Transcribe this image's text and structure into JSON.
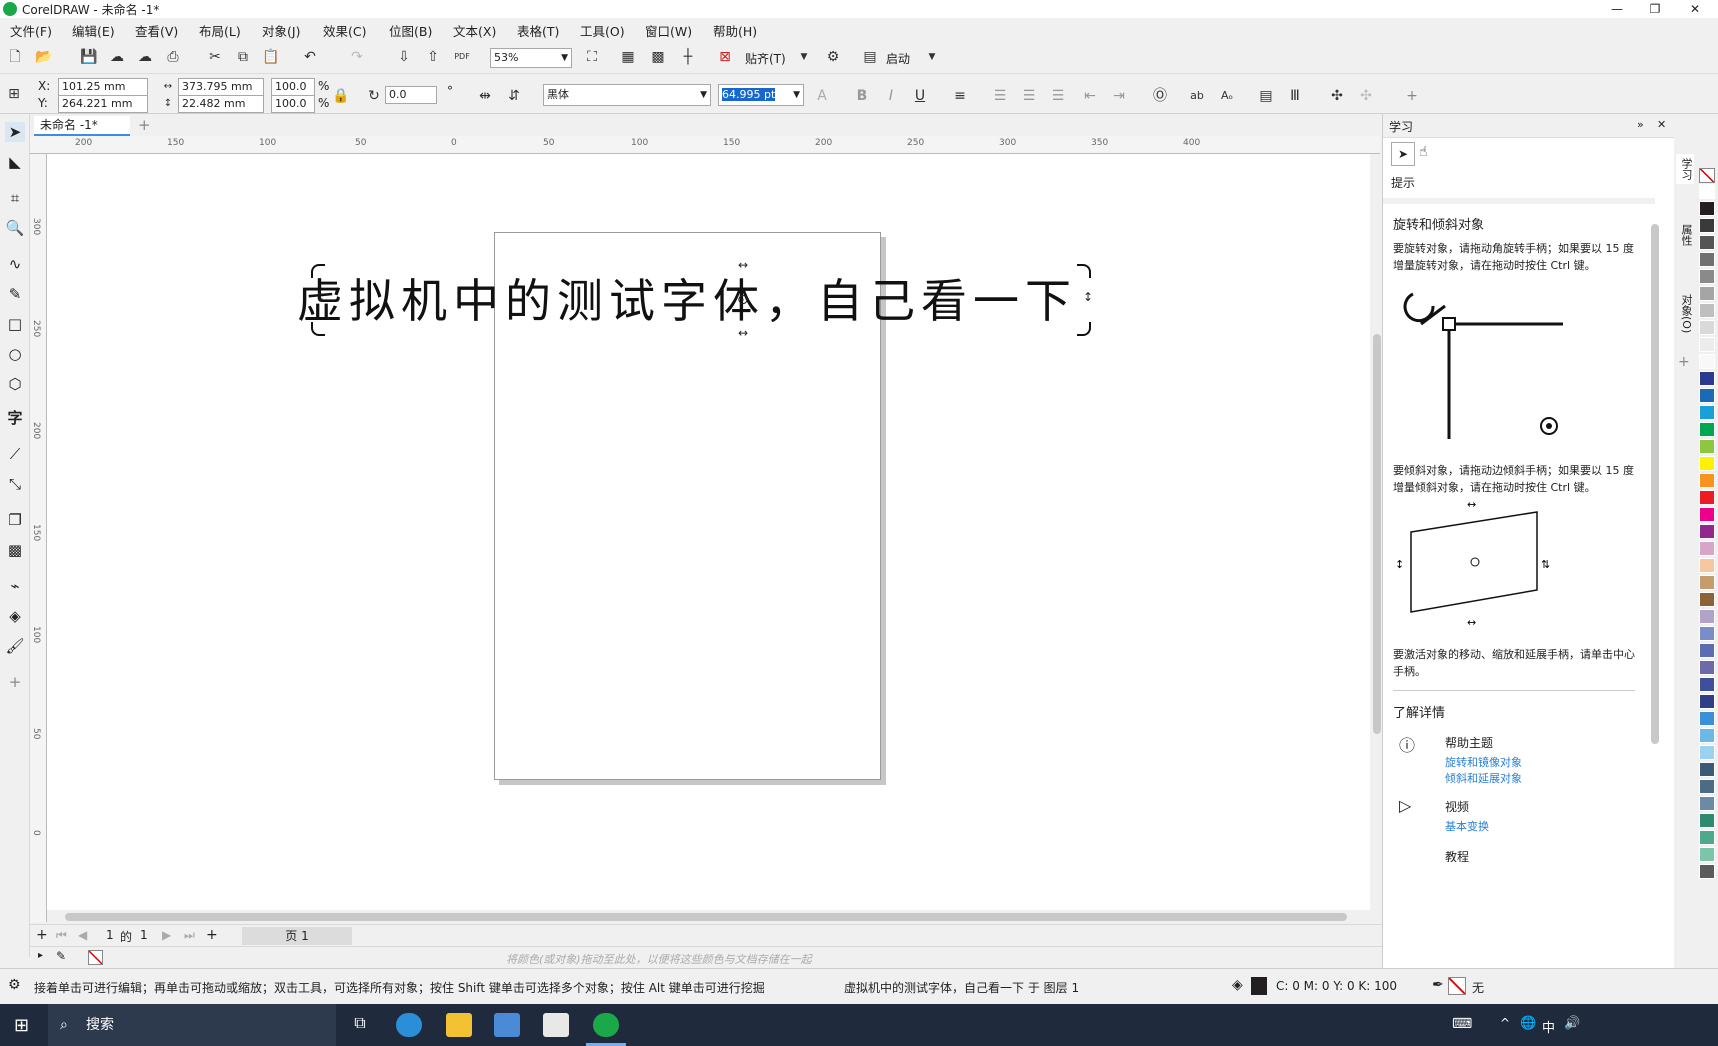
{
  "app": {
    "title": "CorelDRAW - 未命名 -1*"
  },
  "menu": [
    "文件(F)",
    "编辑(E)",
    "查看(V)",
    "布局(L)",
    "对象(J)",
    "效果(C)",
    "位图(B)",
    "文本(X)",
    "表格(T)",
    "工具(O)",
    "窗口(W)",
    "帮助(H)"
  ],
  "stdbar": {
    "zoom": "53%",
    "snap": "贴齐(T)",
    "launch": "启动"
  },
  "props": {
    "x_label": "X:",
    "x": "101.25 mm",
    "y_label": "Y:",
    "y": "264.221 mm",
    "w": "373.795 mm",
    "h": "22.482 mm",
    "sx": "100.0",
    "sy": "100.0",
    "pct": "%",
    "angle": "0.0",
    "deg": "°",
    "font": "黑体",
    "font_size": "64.995 pt"
  },
  "document": {
    "tab": "未命名 -1*",
    "text": "虚拟机中的测试字体，自己看一下"
  },
  "ruler": {
    "h": [
      "200",
      "150",
      "100",
      "50",
      "0",
      "50",
      "100",
      "150",
      "200",
      "250",
      "300",
      "350",
      "400"
    ],
    "v": [
      "300",
      "250",
      "200",
      "150",
      "100",
      "50",
      "0"
    ]
  },
  "pagenav": {
    "current": "1",
    "of": "的",
    "total": "1",
    "page": "页 1"
  },
  "palette_hint": "将颜色(或对象)拖动至此处，以便将这些颜色与文档存储在一起",
  "docker": {
    "title": "学习",
    "hint_label": "提示",
    "section": "旋转和倾斜对象",
    "p1": "要旋转对象，请拖动角旋转手柄；如果要以 15 度增量旋转对象，请在拖动时按住 Ctrl 键。",
    "p2": "要倾斜对象，请拖动边倾斜手柄；如果要以 15 度增量倾斜对象，请在拖动时按住 Ctrl 键。",
    "p3": "要激活对象的移动、缩放和延展手柄，请单击中心手柄。",
    "more": "了解详情",
    "help_title": "帮助主题",
    "help_link1": "旋转和镜像对象",
    "help_link2": "倾斜和延展对象",
    "video_title": "视频",
    "video_link": "基本变换",
    "tutorial": "教程",
    "tabs": [
      "学习",
      "属性",
      "对象(O)"
    ]
  },
  "palette_colors": [
    "#ffffff",
    "#231f20",
    "#3a3a3a",
    "#555555",
    "#707070",
    "#8a8a8a",
    "#a5a5a5",
    "#bfbfbf",
    "#d9d9d9",
    "#ececec",
    "#f8f8f8",
    "#2b3a8f",
    "#1d6ab4",
    "#1aa0d8",
    "#00a651",
    "#8dc63f",
    "#fff200",
    "#f7941d",
    "#ed1c24",
    "#ec008c",
    "#92278f",
    "#d7a5c8",
    "#f5c89f",
    "#c69c6d",
    "#8c6239",
    "#b3a2c7",
    "#7b8dc7",
    "#5a6db2",
    "#6d6aa8",
    "#3f4f9a",
    "#2f3f87",
    "#3b8fd6",
    "#6cb8e6",
    "#9ad2ef",
    "#3c5a77",
    "#4e6b86",
    "#6d8aa4",
    "#2e8a6e",
    "#4ea88a",
    "#7dc5a8",
    "#5b5b5b"
  ],
  "status": {
    "hint": "接着单击可进行编辑；再单击可拖动或缩放；双击工具，可选择所有对象；按住 Shift 键单击可选择多个对象；按住 Alt 键单击可进行挖掘",
    "object": "虚拟机中的测试字体，自己看一下 于 图层 1",
    "fill": "C: 0 M: 0 Y: 0 K: 100",
    "outline": "无"
  },
  "taskbar": {
    "search": "搜索",
    "ime": "中"
  }
}
